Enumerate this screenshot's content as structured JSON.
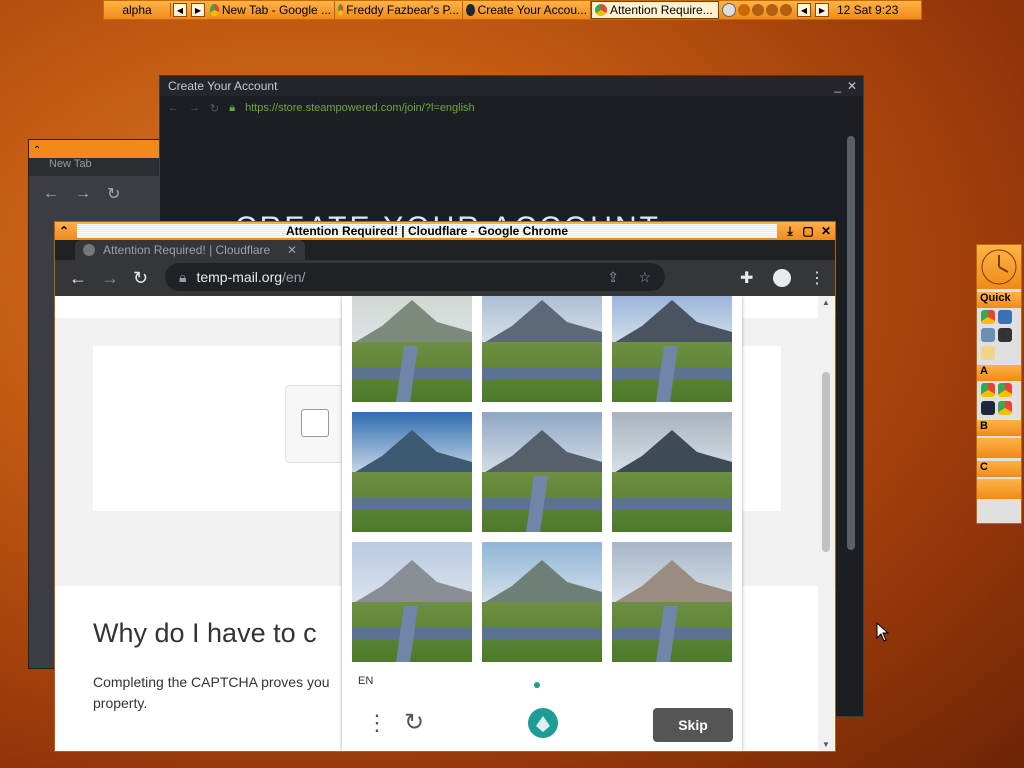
{
  "taskbar": {
    "workspace": "alpha",
    "tasks": [
      {
        "label": "New Tab - Google ..."
      },
      {
        "label": "Freddy Fazbear's P..."
      },
      {
        "label": "Create Your Accou..."
      },
      {
        "label": "Attention Require..."
      }
    ],
    "clock": "12 Sat 9:23"
  },
  "steam_window": {
    "title": "Create Your Account",
    "url": "https://store.steampowered.com/join/?l=english",
    "heading": "CREATE YOUR ACCOUNT"
  },
  "newtab_window": {
    "tab_label": "New Tab"
  },
  "chrome_window": {
    "title": "Attention Required! | Cloudflare - Google Chrome",
    "tab_label": "Attention Required! | Cloudflare",
    "url_domain": "temp-mail.org",
    "url_path": "/en/"
  },
  "page": {
    "why_heading": "Why do I have to c",
    "completing_text": "Completing the CAPTCHA proves you",
    "completing_text2": "property."
  },
  "captcha": {
    "language": "EN",
    "skip_label": "Skip",
    "tiles": 9
  },
  "side_panel": {
    "quick": "Quick",
    "group_a": "A",
    "group_b": "B",
    "group_c": "C"
  },
  "colors": {
    "accent_orange": "#f08a1a",
    "steam_url_green": "#6fa83f",
    "hcaptcha_teal": "#1e9c95"
  }
}
